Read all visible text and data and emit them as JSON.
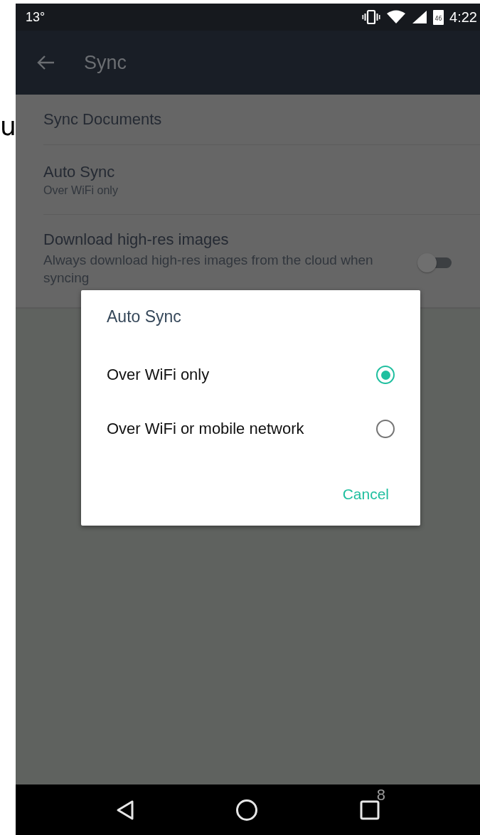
{
  "edge_text": "u",
  "status_bar": {
    "temperature": "13°",
    "battery_level_text": "46",
    "time": "4:22"
  },
  "toolbar": {
    "title": "Sync"
  },
  "settings": [
    {
      "kind": "plain",
      "title": "Sync Documents"
    },
    {
      "kind": "summary",
      "title": "Auto Sync",
      "summary": "Over WiFi only"
    },
    {
      "kind": "switch",
      "title": "Download high-res images",
      "summary": "Always download high-res images from the cloud when syncing",
      "on": false
    }
  ],
  "dialog": {
    "title": "Auto Sync",
    "options": [
      {
        "label": "Over WiFi only",
        "selected": true
      },
      {
        "label": "Over WiFi or mobile network",
        "selected": false
      }
    ],
    "buttons": [
      "Cancel"
    ]
  },
  "nav_bar": {
    "recents_badge": "8"
  }
}
